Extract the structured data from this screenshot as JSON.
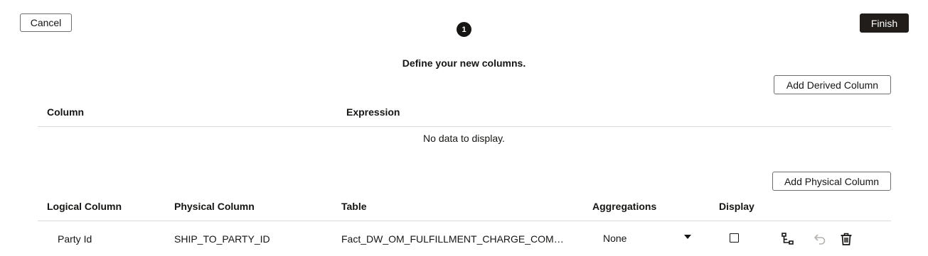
{
  "header": {
    "cancel_label": "Cancel",
    "finish_label": "Finish",
    "step_number": "1"
  },
  "instruction": "Define your new columns.",
  "derived_section": {
    "add_button_label": "Add Derived Column",
    "columns": [
      "Column",
      "Expression"
    ],
    "empty_message": "No data to display."
  },
  "physical_section": {
    "add_button_label": "Add Physical Column",
    "columns": [
      "Logical Column",
      "Physical Column",
      "Table",
      "Aggregations",
      "Display"
    ],
    "rows": [
      {
        "logical_column": "Party Id",
        "physical_column": "SHIP_TO_PARTY_ID",
        "table": "Fact_DW_OM_FULFILLMENT_CHARGE_COMP…",
        "aggregation": "None",
        "display_checked": false,
        "row_actions": [
          "hierarchy-icon",
          "undo-icon",
          "delete-icon"
        ]
      }
    ]
  },
  "colors": {
    "primary_button_bg": "#201d1b",
    "divider": "#dcdad7",
    "text": "#161513",
    "disabled_icon": "#b3b0ad"
  }
}
